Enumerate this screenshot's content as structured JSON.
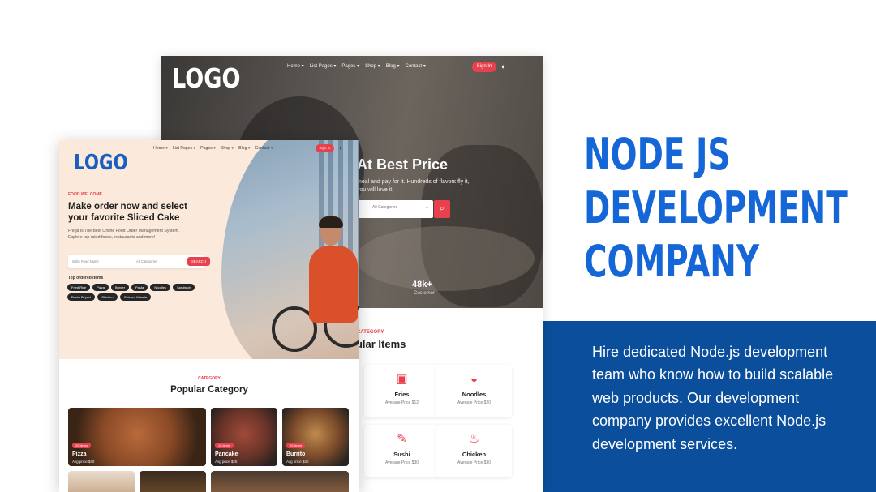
{
  "page": {
    "heading_lines": [
      "NODE JS",
      "DEVELOPMENT",
      "COMPANY"
    ],
    "description": "Hire dedicated Node.js development team who know how to build scalable web products. Our development company provides excellent Node.js development services."
  },
  "back_site": {
    "logo": "LOGO",
    "nav": [
      "Home ▾",
      "List Pages ▾",
      "Pages ▾",
      "Shop ▾",
      "Blog ▾",
      "Contact ▾"
    ],
    "signin": "Sign In",
    "hero_title": "At Best Price",
    "hero_sub": "meal and pay for it. Hundreds of flavors fly it, you will love it.",
    "search_select": "All Categories",
    "stat_value": "48k+",
    "stat_label": "Customer",
    "section_eyebrow": "CATEGORY",
    "section_title": "pular Items",
    "items": [
      {
        "name": "Fries",
        "price": "Average Price $12",
        "icon": "fries-icon",
        "glyph": "▣"
      },
      {
        "name": "Noodles",
        "price": "Average Price $20",
        "icon": "noodles-icon",
        "glyph": "◒"
      },
      {
        "name": "Sushi",
        "price": "Average Price $30",
        "icon": "sushi-icon",
        "glyph": "✎"
      },
      {
        "name": "Chicken",
        "price": "Average Price $30",
        "icon": "chicken-icon",
        "glyph": "♨"
      }
    ]
  },
  "front_site": {
    "logo": "LOGO",
    "nav": [
      "Home ▾",
      "List Pages ▾",
      "Pages ▾",
      "Shop ▾",
      "Blog ▾",
      "Contact ▾"
    ],
    "signin": "Sign In",
    "eyebrow": "FOOD WELCOME",
    "headline": "Make order now and select your favorite Sliced Cake",
    "sub": "Frega is The Best Online Food Order Management System. Explore top rated foods, restaurants and more!",
    "search_placeholder": "Write Food Name",
    "search_select": "All Categories",
    "search_button": "SEARCH",
    "tags_title": "Top ordered items",
    "tags": [
      "Fried Rice",
      "Pizza",
      "Burger",
      "Pasta",
      "Noodles",
      "Sandwich",
      "Bucks Biryani",
      "Chicken",
      "Chicken Masala"
    ],
    "category_eyebrow": "CATEGORY",
    "category_title": "Popular Category",
    "categories": [
      {
        "name": "Pizza",
        "price": "Avg price $40",
        "badge": "20 items"
      },
      {
        "name": "Pancake",
        "price": "Avg price $25",
        "badge": "15 items"
      },
      {
        "name": "Burrito",
        "price": "Avg price $40",
        "badge": "20 items"
      }
    ]
  }
}
